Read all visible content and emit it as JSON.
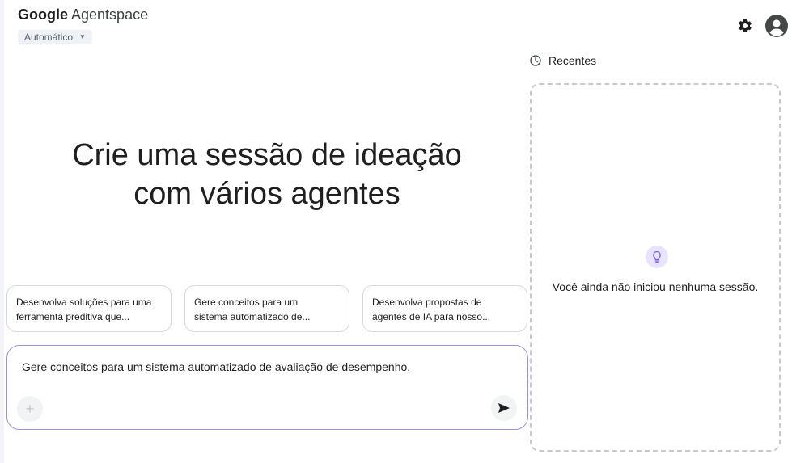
{
  "header": {
    "brand_bold": "Google",
    "brand_light": "Agentspace",
    "model_label": "Automático",
    "icons": [
      "settings-icon",
      "account-icon"
    ]
  },
  "main": {
    "hero_line1": "Crie uma sessão de ideação",
    "hero_line2": "com vários agentes",
    "suggestions": [
      {
        "line1": "Desenvolva soluções para uma",
        "line2": "ferramenta preditiva que..."
      },
      {
        "line1": "Gere conceitos para um",
        "line2": "sistema automatizado de..."
      },
      {
        "line1": "Desenvolva propostas de",
        "line2": "agentes de IA para nosso..."
      }
    ],
    "composer_text": "Gere conceitos para um sistema automatizado de avaliação de desempenho."
  },
  "recent": {
    "title": "Recentes",
    "empty_message": "Você ainda não iniciou nenhuma sessão."
  },
  "colors": {
    "accent": "#9c8fe0",
    "badge_bg": "#e9e3ff",
    "bulb": "#7b61e8"
  }
}
